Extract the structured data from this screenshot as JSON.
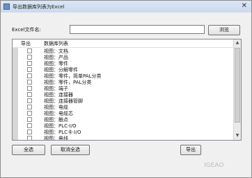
{
  "window": {
    "title": "导出数据库列表为Excel",
    "close_glyph": "✕"
  },
  "form": {
    "excel_label": "Excel文件名:",
    "path_value": "",
    "browse_label": "浏览"
  },
  "list": {
    "columns": {
      "export": "导出",
      "name": "数据库列表"
    },
    "rows": [
      "视图：文档",
      "视图：产品",
      "视图：零件",
      "视图：分解零件",
      "视图：零件，简单PAL分类",
      "视图：零件，PAL分类",
      "视图：端子",
      "视图：连接器",
      "视图：连接器管脚",
      "视图：电缆",
      "视图：电缆芯",
      "视图：触点",
      "视图：PLC-I/O",
      "视图：PLC卡-I/O",
      "视图：电线",
      "视图：…"
    ]
  },
  "buttons": {
    "select_all": "全选",
    "deselect_all": "取消全选",
    "export": "导出"
  },
  "watermark": "IGEAO"
}
